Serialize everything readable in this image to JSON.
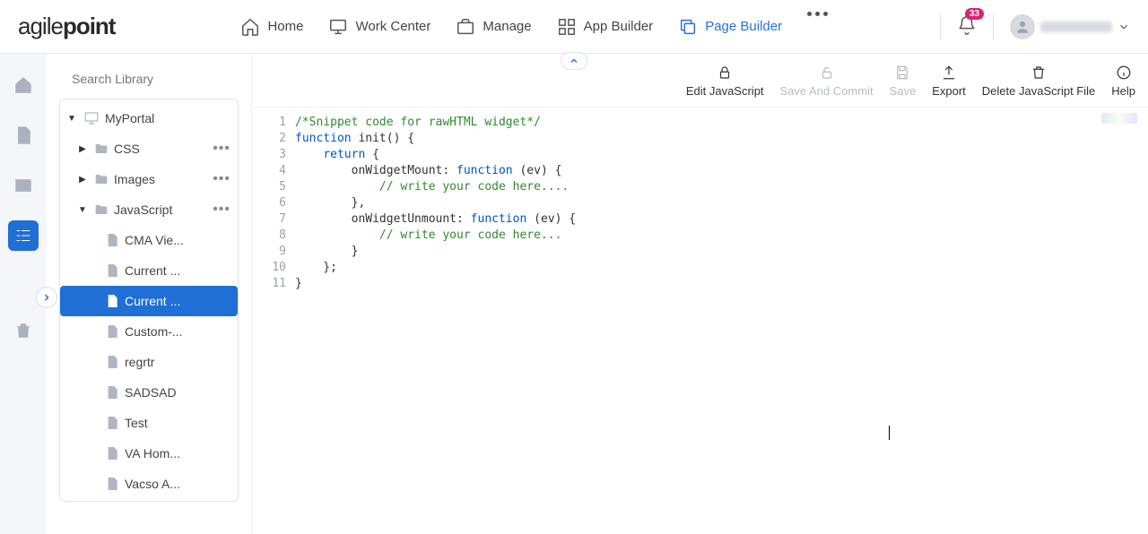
{
  "brand": {
    "pre": "agile",
    "bold": "point"
  },
  "nav": {
    "home": "Home",
    "work": "Work Center",
    "manage": "Manage",
    "appbuilder": "App Builder",
    "pagebuilder": "Page Builder"
  },
  "notifications": {
    "count": "33"
  },
  "search": {
    "placeholder": "Search Library"
  },
  "tree": {
    "root": "MyPortal",
    "folders": {
      "css": "CSS",
      "images": "Images",
      "js": "JavaScript"
    },
    "files": {
      "cma": "CMA Vie...",
      "current1": "Current ...",
      "current2": "Current ...",
      "custom": "Custom-...",
      "regrtr": "regrtr",
      "sadsad": "SADSAD",
      "test": "Test",
      "vahome": "VA Hom...",
      "vacso": "Vacso A..."
    }
  },
  "toolbar": {
    "edit": "Edit JavaScript",
    "savecommit": "Save And Commit",
    "save": "Save",
    "export": "Export",
    "delete": "Delete JavaScript File",
    "help": "Help"
  },
  "code": {
    "lines": [
      "1",
      "2",
      "3",
      "4",
      "5",
      "6",
      "7",
      "8",
      "9",
      "10",
      "11"
    ],
    "l1_comment": "/*Snippet code for rawHTML widget*/",
    "l2_kw": "function",
    "l2_name": " init() {",
    "l3_kw": "return",
    "l3_rest": " {",
    "l4_prop": "        onWidgetMount: ",
    "l4_kw": "function",
    "l4_rest": " (ev) {",
    "l5_comment": "            // write your code here....",
    "l6": "        },",
    "l7_prop": "        onWidgetUnmount: ",
    "l7_kw": "function",
    "l7_rest": " (ev) {",
    "l8_comment": "            // write your code here...",
    "l9": "        }",
    "l10": "    };",
    "l11": "}"
  }
}
